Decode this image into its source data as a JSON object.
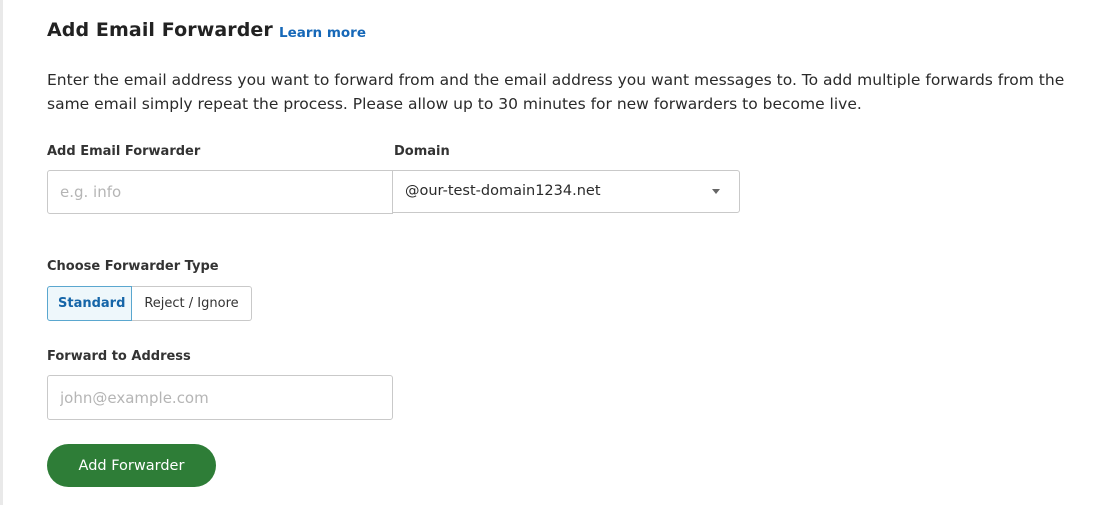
{
  "header": {
    "title": "Add Email Forwarder",
    "learn_more": "Learn more"
  },
  "description": "Enter the email address you want to forward from and the email address you want messages to. To add multiple forwards from the same email simply repeat the process. Please allow up to 30 minutes for new forwarders to become live.",
  "form": {
    "forwarder_label": "Add Email Forwarder",
    "forwarder_placeholder": "e.g. info",
    "forwarder_value": "",
    "domain_label": "Domain",
    "domain_selected": "@our-test-domain1234.net",
    "type_label": "Choose Forwarder Type",
    "type_options": [
      "Standard",
      "Reject / Ignore"
    ],
    "type_selected": "Standard",
    "forward_to_label": "Forward to Address",
    "forward_to_placeholder": "john@example.com",
    "forward_to_value": "",
    "submit_label": "Add Forwarder"
  },
  "icons": {
    "domain_dropdown": "caret-down-icon"
  },
  "colors": {
    "link": "#1668b8",
    "primary_button": "#2e7d37",
    "selected_toggle_bg": "#eef7fb",
    "selected_toggle_border": "#5aa7cf",
    "selected_toggle_text": "#1565a8"
  }
}
